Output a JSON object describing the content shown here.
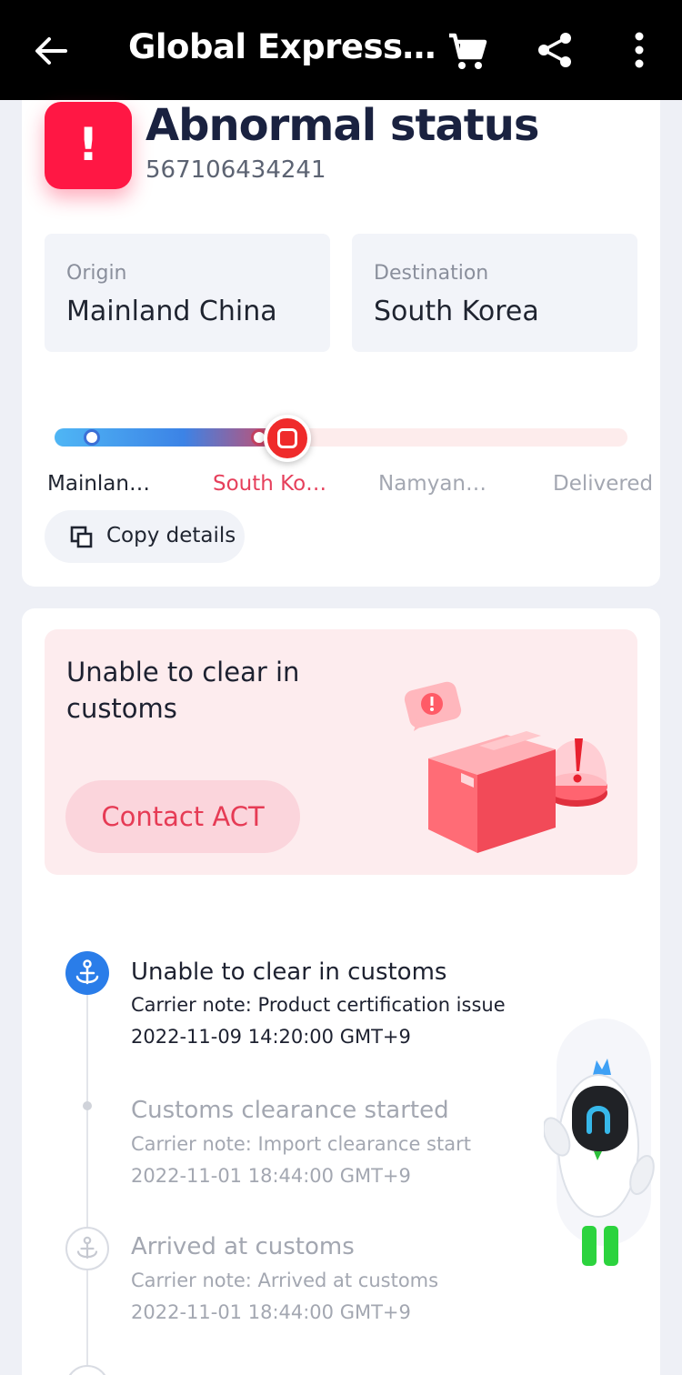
{
  "appbar": {
    "title": "Global Express…"
  },
  "status": {
    "title": "Abnormal status",
    "tracking_number": "567106434241",
    "alert_symbol": "!"
  },
  "route": {
    "origin_label": "Origin",
    "origin_value": "Mainland China",
    "destination_label": "Destination",
    "destination_value": "South Korea"
  },
  "progress": {
    "stages": [
      "Mainlan…",
      "South Ko…",
      "Namyan…",
      "Delivered"
    ],
    "current_stage_index": 1,
    "fill_fraction": 0.41
  },
  "copy_button": {
    "label": "Copy details"
  },
  "exception": {
    "message": "Unable to clear in customs",
    "contact_label": "Contact ACT"
  },
  "events": [
    {
      "title": "Unable to clear in customs",
      "note": "Carrier note: Product certification issue",
      "time": "2022-11-09 14:20:00 GMT+9"
    },
    {
      "title": "Customs clearance started",
      "note": "Carrier note: Import clearance start",
      "time": "2022-11-01 18:44:00 GMT+9"
    },
    {
      "title": "Arrived at customs",
      "note": "Carrier note: Arrived at customs",
      "time": "2022-11-01 18:44:00 GMT+9"
    }
  ],
  "colors": {
    "alert": "#ff1744",
    "accent_blue": "#2a7de9",
    "contact_text": "#e63b55",
    "stage_active": "#e6405c"
  },
  "icons": {
    "back": "arrow-left-icon",
    "cart": "shopping-cart-icon",
    "share": "share-icon",
    "more": "more-vertical-icon",
    "copy": "copy-icon",
    "anchor": "anchor-icon"
  }
}
